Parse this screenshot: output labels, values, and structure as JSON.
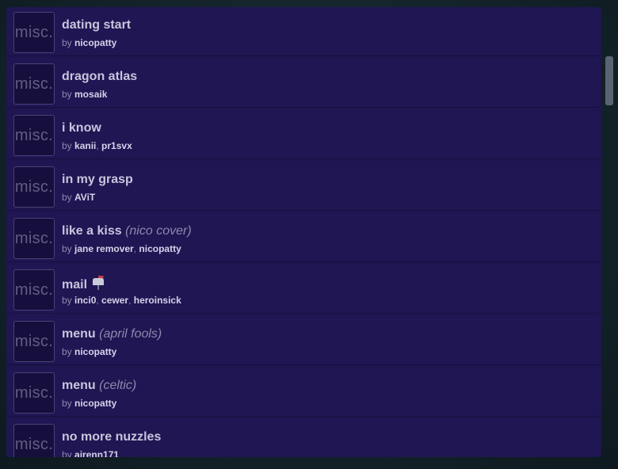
{
  "thumbnail_label": "misc.",
  "by_label": "by",
  "items": [
    {
      "title": "dating start",
      "subtitle": "",
      "artists": [
        "nicopatty"
      ]
    },
    {
      "title": "dragon atlas",
      "subtitle": "",
      "artists": [
        "mosaik"
      ]
    },
    {
      "title": "i know",
      "subtitle": "",
      "artists": [
        "kanii",
        "pr1svx"
      ]
    },
    {
      "title": "in my grasp",
      "subtitle": "",
      "artists": [
        "AViT"
      ]
    },
    {
      "title": "like a kiss",
      "subtitle": "(nico cover)",
      "artists": [
        "jane remover",
        "nicopatty"
      ]
    },
    {
      "title": "mail",
      "subtitle": "",
      "icon": "mailbox-icon",
      "artists": [
        "inci0",
        "cewer",
        "heroinsick"
      ]
    },
    {
      "title": "menu",
      "subtitle": "(april fools)",
      "artists": [
        "nicopatty"
      ]
    },
    {
      "title": "menu",
      "subtitle": "(celtic)",
      "artists": [
        "nicopatty"
      ]
    },
    {
      "title": "no more nuzzles",
      "subtitle": "",
      "artists": [
        "airenn171"
      ]
    }
  ]
}
